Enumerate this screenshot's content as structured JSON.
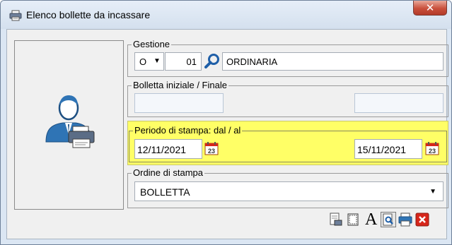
{
  "window": {
    "title": "Elenco bollette da incassare",
    "icons": {
      "app": "printer-icon",
      "close": "close-x-icon"
    }
  },
  "gestione": {
    "label": "Gestione",
    "type_code": "O",
    "code": "01",
    "description": "ORDINARIA",
    "search_icon": "magnifier-icon"
  },
  "bolletta": {
    "label": "Bolletta iniziale / Finale",
    "start": "",
    "end": ""
  },
  "periodo": {
    "label": "Periodo di stampa: dal / al",
    "from": "12/11/2021",
    "to": "15/11/2021",
    "calendar_icon": "calendar-icon",
    "calendar_day": "23",
    "highlight_color": "#ffff66"
  },
  "ordine": {
    "label": "Ordine di stampa",
    "value": "BOLLETTA"
  },
  "side_icon": "user-printer-icon",
  "toolbar": {
    "buttons": [
      "print-preview-icon",
      "page-setup-icon",
      "font-icon",
      "preview-icon",
      "print-icon",
      "exit-icon"
    ],
    "font_glyph": "A"
  }
}
